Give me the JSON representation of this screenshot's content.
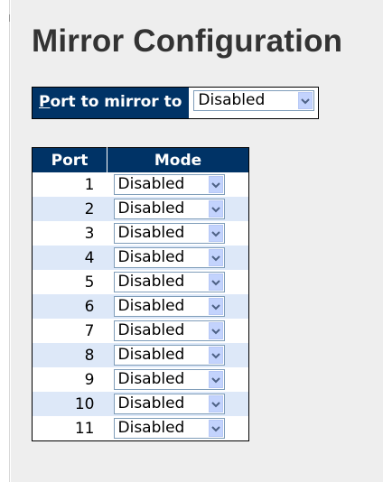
{
  "page": {
    "title": "Mirror Configuration"
  },
  "mirror": {
    "label_accesskey": "P",
    "label_rest": "ort to mirror to",
    "selected": "Disabled"
  },
  "table": {
    "headers": [
      "Port",
      "Mode"
    ],
    "rows": [
      {
        "port": "1",
        "mode": "Disabled"
      },
      {
        "port": "2",
        "mode": "Disabled"
      },
      {
        "port": "3",
        "mode": "Disabled"
      },
      {
        "port": "4",
        "mode": "Disabled"
      },
      {
        "port": "5",
        "mode": "Disabled"
      },
      {
        "port": "6",
        "mode": "Disabled"
      },
      {
        "port": "7",
        "mode": "Disabled"
      },
      {
        "port": "8",
        "mode": "Disabled"
      },
      {
        "port": "9",
        "mode": "Disabled"
      },
      {
        "port": "10",
        "mode": "Disabled"
      },
      {
        "port": "11",
        "mode": "Disabled"
      }
    ]
  },
  "icons": {
    "dropdown": "chevron-down-icon"
  },
  "colors": {
    "header_bg": "#003366",
    "row_alt_bg": "#dde8f8",
    "page_bg": "#eeeeee",
    "dropdown_button": "#c3d3fd"
  }
}
